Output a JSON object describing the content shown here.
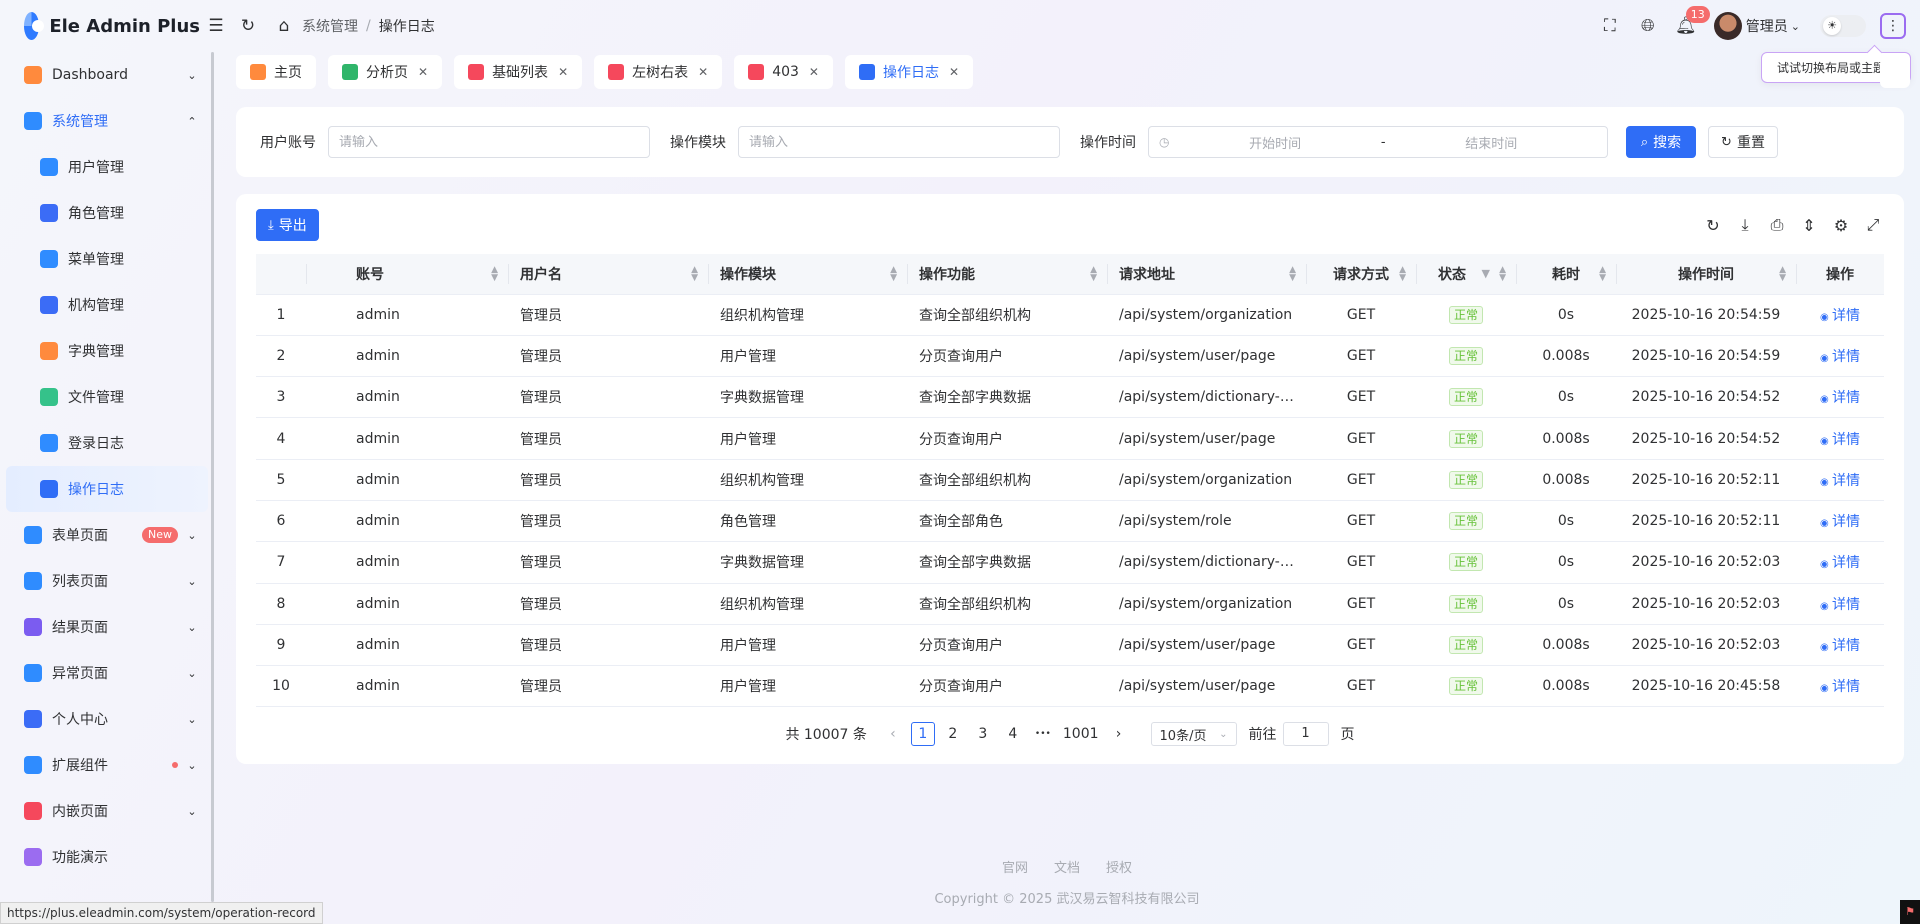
{
  "app": {
    "title": "Ele Admin Plus"
  },
  "breadcrumb": [
    "系统管理",
    "操作日志"
  ],
  "header": {
    "notification_count": "13",
    "user_name": "管理员",
    "tooltip": "试试切换布局或主题~"
  },
  "sidebar": {
    "items": [
      {
        "label": "Dashboard",
        "icon": "dashboard-icon",
        "color": "#ff8a3d",
        "chev": "⌄"
      },
      {
        "label": "系统管理",
        "icon": "system-icon",
        "color": "#2f8cff",
        "chev": "⌃",
        "open": true
      },
      {
        "label": "用户管理",
        "icon": "user-manage-icon",
        "color": "#2f8cff",
        "sub": true
      },
      {
        "label": "角色管理",
        "icon": "role-icon",
        "color": "#3b6cf6",
        "sub": true
      },
      {
        "label": "菜单管理",
        "icon": "menu-icon",
        "color": "#2f8cff",
        "sub": true
      },
      {
        "label": "机构管理",
        "icon": "org-icon",
        "color": "#3b6cf6",
        "sub": true
      },
      {
        "label": "字典管理",
        "icon": "dict-icon",
        "color": "#ff8a3d",
        "sub": true
      },
      {
        "label": "文件管理",
        "icon": "file-icon",
        "color": "#35c28a",
        "sub": true
      },
      {
        "label": "登录日志",
        "icon": "login-log-icon",
        "color": "#2f8cff",
        "sub": true
      },
      {
        "label": "操作日志",
        "icon": "operation-log-icon",
        "color": "#2f6df6",
        "sub": true,
        "active": true
      },
      {
        "label": "表单页面",
        "icon": "form-icon",
        "color": "#2f8cff",
        "chev": "⌄",
        "tag": "New"
      },
      {
        "label": "列表页面",
        "icon": "list-icon",
        "color": "#2f8cff",
        "chev": "⌄"
      },
      {
        "label": "结果页面",
        "icon": "result-icon",
        "color": "#7b5cf0",
        "chev": "⌄"
      },
      {
        "label": "异常页面",
        "icon": "exception-icon",
        "color": "#2f8cff",
        "chev": "⌄"
      },
      {
        "label": "个人中心",
        "icon": "profile-icon",
        "color": "#3b6cf6",
        "chev": "⌄"
      },
      {
        "label": "扩展组件",
        "icon": "extension-icon",
        "color": "#2f8cff",
        "chev": "⌄",
        "dot": true
      },
      {
        "label": "内嵌页面",
        "icon": "iframe-icon",
        "color": "#f5485c",
        "chev": "⌄"
      },
      {
        "label": "功能演示",
        "icon": "demo-icon",
        "color": "#9b6cf0"
      }
    ]
  },
  "tabs": [
    {
      "label": "主页",
      "icon": "home-tab-icon",
      "color": "#ff8a3d",
      "closable": false
    },
    {
      "label": "分析页",
      "icon": "analysis-icon",
      "color": "#2fb56a",
      "closable": true
    },
    {
      "label": "基础列表",
      "icon": "basic-list-icon",
      "color": "#f5485c",
      "closable": true
    },
    {
      "label": "左树右表",
      "icon": "tree-table-icon",
      "color": "#f5485c",
      "closable": true
    },
    {
      "label": "403",
      "icon": "forbidden-icon",
      "color": "#f5485c",
      "closable": true
    },
    {
      "label": "操作日志",
      "icon": "operation-log-tab-icon",
      "color": "#2f6df6",
      "closable": true,
      "active": true
    }
  ],
  "search": {
    "account_label": "用户账号",
    "account_placeholder": "请输入",
    "module_label": "操作模块",
    "module_placeholder": "请输入",
    "time_label": "操作时间",
    "start_placeholder": "开始时间",
    "range_sep": "-",
    "end_placeholder": "结束时间",
    "search_btn": "搜索",
    "reset_btn": "重置"
  },
  "toolbar": {
    "export_btn": "导出"
  },
  "table": {
    "columns": [
      "",
      "账号",
      "用户名",
      "操作模块",
      "操作功能",
      "请求地址",
      "请求方式",
      "状态",
      "耗时",
      "操作时间",
      "操作"
    ],
    "detail_label": "详情",
    "rows": [
      {
        "idx": "1",
        "account": "admin",
        "username": "管理员",
        "module": "组织机构管理",
        "func": "查询全部组织机构",
        "url": "/api/system/organization",
        "method": "GET",
        "status": "正常",
        "cost": "0s",
        "time": "2025-10-16 20:54:59"
      },
      {
        "idx": "2",
        "account": "admin",
        "username": "管理员",
        "module": "用户管理",
        "func": "分页查询用户",
        "url": "/api/system/user/page",
        "method": "GET",
        "status": "正常",
        "cost": "0.008s",
        "time": "2025-10-16 20:54:59"
      },
      {
        "idx": "3",
        "account": "admin",
        "username": "管理员",
        "module": "字典数据管理",
        "func": "查询全部字典数据",
        "url": "/api/system/dictionary-data",
        "method": "GET",
        "status": "正常",
        "cost": "0s",
        "time": "2025-10-16 20:54:52"
      },
      {
        "idx": "4",
        "account": "admin",
        "username": "管理员",
        "module": "用户管理",
        "func": "分页查询用户",
        "url": "/api/system/user/page",
        "method": "GET",
        "status": "正常",
        "cost": "0.008s",
        "time": "2025-10-16 20:54:52"
      },
      {
        "idx": "5",
        "account": "admin",
        "username": "管理员",
        "module": "组织机构管理",
        "func": "查询全部组织机构",
        "url": "/api/system/organization",
        "method": "GET",
        "status": "正常",
        "cost": "0.008s",
        "time": "2025-10-16 20:52:11"
      },
      {
        "idx": "6",
        "account": "admin",
        "username": "管理员",
        "module": "角色管理",
        "func": "查询全部角色",
        "url": "/api/system/role",
        "method": "GET",
        "status": "正常",
        "cost": "0s",
        "time": "2025-10-16 20:52:11"
      },
      {
        "idx": "7",
        "account": "admin",
        "username": "管理员",
        "module": "字典数据管理",
        "func": "查询全部字典数据",
        "url": "/api/system/dictionary-data",
        "method": "GET",
        "status": "正常",
        "cost": "0s",
        "time": "2025-10-16 20:52:03"
      },
      {
        "idx": "8",
        "account": "admin",
        "username": "管理员",
        "module": "组织机构管理",
        "func": "查询全部组织机构",
        "url": "/api/system/organization",
        "method": "GET",
        "status": "正常",
        "cost": "0s",
        "time": "2025-10-16 20:52:03"
      },
      {
        "idx": "9",
        "account": "admin",
        "username": "管理员",
        "module": "用户管理",
        "func": "分页查询用户",
        "url": "/api/system/user/page",
        "method": "GET",
        "status": "正常",
        "cost": "0.008s",
        "time": "2025-10-16 20:52:03"
      },
      {
        "idx": "10",
        "account": "admin",
        "username": "管理员",
        "module": "用户管理",
        "func": "分页查询用户",
        "url": "/api/system/user/page",
        "method": "GET",
        "status": "正常",
        "cost": "0.008s",
        "time": "2025-10-16 20:45:58"
      }
    ]
  },
  "pagination": {
    "total": "共 10007 条",
    "pages": [
      "1",
      "2",
      "3",
      "4"
    ],
    "ellipsis": "•••",
    "last_page": "1001",
    "page_size": "10条/页",
    "goto_label": "前往",
    "goto_value": "1",
    "page_suffix": "页"
  },
  "footer": {
    "links": [
      "官网",
      "文档",
      "授权"
    ],
    "copyright": "Copyright © 2025 武汉易云智科技有限公司"
  },
  "status_url": "https://plus.eleadmin.com/system/operation-record"
}
